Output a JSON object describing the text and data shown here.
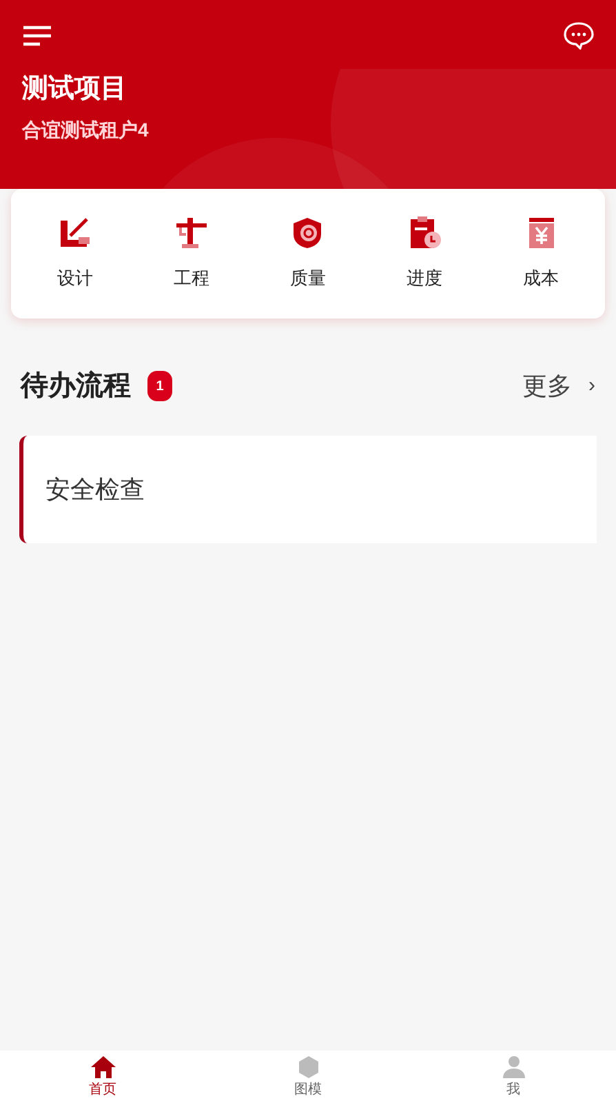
{
  "header": {
    "title": "测试项目",
    "subtitle": "合谊测试租户4"
  },
  "modules": [
    {
      "label": "设计"
    },
    {
      "label": "工程"
    },
    {
      "label": "质量"
    },
    {
      "label": "进度"
    },
    {
      "label": "成本"
    }
  ],
  "todo": {
    "title": "待办流程",
    "count": "1",
    "more": "更多",
    "chevron": "›",
    "items": [
      {
        "label": "安全检查"
      }
    ]
  },
  "tabbar": [
    {
      "label": "首页",
      "selected": true
    },
    {
      "label": "图模",
      "selected": false
    },
    {
      "label": "我",
      "selected": false
    }
  ]
}
